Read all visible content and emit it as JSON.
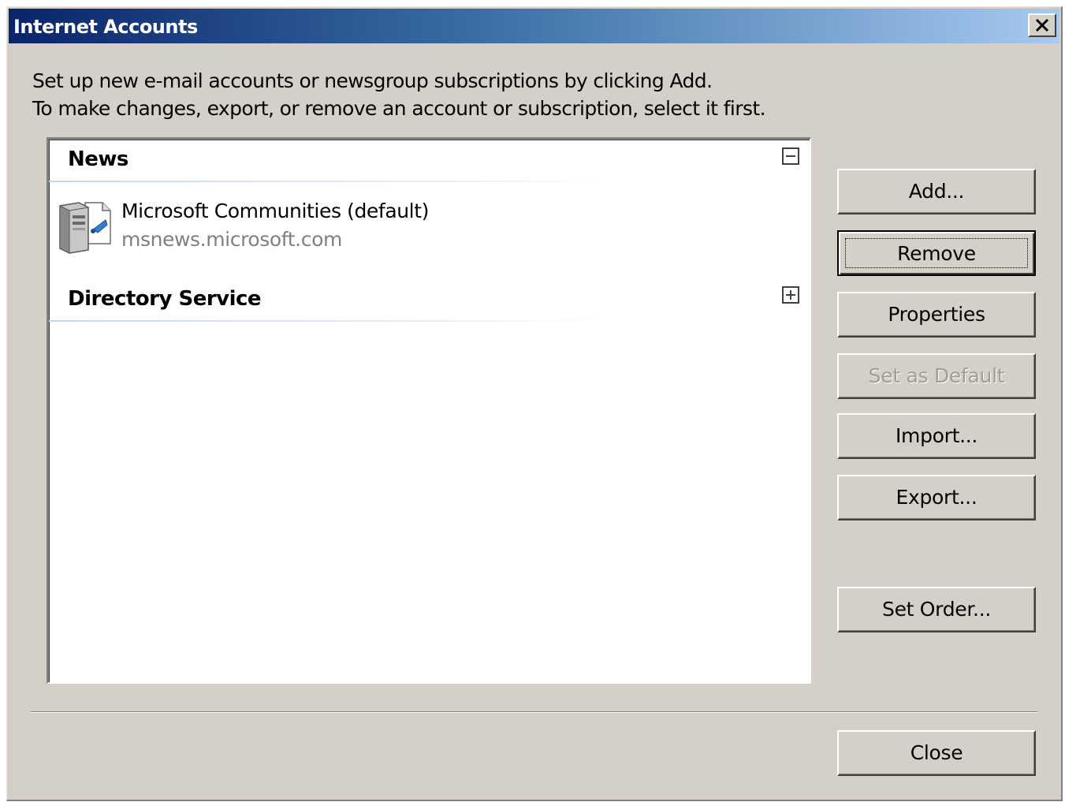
{
  "window": {
    "title": "Internet Accounts",
    "close_glyph": "✕"
  },
  "instructions": {
    "line1": "Set up new e-mail accounts or newsgroup subscriptions by clicking Add.",
    "line2": "To make changes, export, or remove an account or subscription, select it first."
  },
  "list": {
    "groups": [
      {
        "header": "News",
        "state": "expanded",
        "expander_icon": "collapse-minus-icon",
        "accounts": [
          {
            "name": "Microsoft Communities (default)",
            "server": "msnews.microsoft.com",
            "icon": "news-server-icon"
          }
        ]
      },
      {
        "header": "Directory Service",
        "state": "collapsed",
        "expander_icon": "expand-plus-icon",
        "accounts": []
      }
    ]
  },
  "buttons": {
    "add": "Add...",
    "remove": "Remove",
    "properties": "Properties",
    "set_default": "Set as Default",
    "import": "Import...",
    "export": "Export...",
    "set_order": "Set Order...",
    "close": "Close"
  },
  "colors": {
    "titlebar_start": "#0a246a",
    "titlebar_end": "#a6caf0",
    "dialog_face": "#d4d0c8",
    "disabled_text": "#a09c94",
    "server_text": "#808080"
  }
}
